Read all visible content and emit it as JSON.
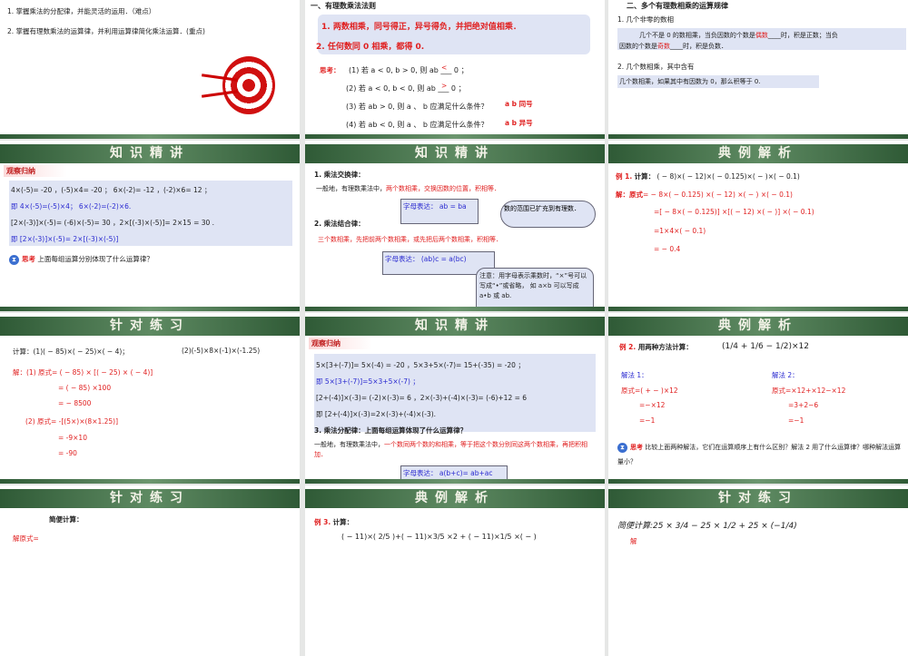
{
  "slides": [
    {
      "goals": [
        "1. 掌握乘法的分配律，并能灵活的运用．（难点）",
        "2. 掌握有理数乘法的运算律，并利用运算律简化乘法运算．(重点)"
      ]
    },
    {
      "heading": "一、有理数乘法法则",
      "rules": [
        "1. 两数相乘，同号得正，异号得负，并把绝对值相乘．",
        "2. 任何数同 0 相乘，都得 0."
      ],
      "think_label": "思考：",
      "questions": [
        "(1) 若 a < 0, b > 0, 则 ab ___ 0 ；",
        "(2) 若 a < 0, b < 0, 则 ab ___ 0 ；",
        "(3) 若 ab > 0, 则 a 、 b 应满足什么条件？",
        "(4) 若 ab < 0, 则 a 、 b 应满足什么条件？"
      ],
      "answers": [
        "<",
        ">",
        "a b 同号",
        "a b 异号"
      ]
    },
    {
      "heading": "二、多个有理数相乘的运算规律",
      "sub1": "1. 几个非零的数相",
      "box1a": "几个不是 0 的数相乘，当负因数的个数是",
      "ans1": "偶数",
      "box1b": "时，积是正数；当负",
      "box1c": "因数的个数是",
      "ans2": "奇数",
      "box1d": "时，积是负数．",
      "sub2": "2. 几个数相乘，其中含有",
      "box2": "几个数相乘，如果其中有因数为 0，那么积等于 0."
    },
    {
      "title": "知识精讲",
      "tag": "观察归纳",
      "lines": [
        "4×(-5)= -20 ，(-5)×4= -20 ；    6×(-2)= -12 ，(-2)×6= 12 ；",
        "即 4×(-5)=(-5)×4； 6×(-2)=(-2)×6.",
        "[2×(-3)]×(-5)= (-6)×(-5)= 30 ，2×[(-3)×(-5)]= 2×15 = 30 .",
        "即 [2×(-3)]×(-5)= 2×[(-3)×(-5)]"
      ],
      "think": "思考",
      "question": "上面每组运算分别体现了什么运算律？"
    },
    {
      "title": "知识精讲",
      "l1": "1. 乘法交换律：",
      "l1b": "一般地，有理数乘法中，",
      "l1r": "两个数相乘，交换因数的位置，积相等．",
      "f1": "字母表达： ab = ba",
      "cloud": "数的范围已扩充到有理数．",
      "l2": "2. 乘法结合律：",
      "l2r": "三个数相乘，先把前两个数相乘，或先把后两个数相乘，积相等．",
      "f2": "字母表达： (ab)c = a(bc)",
      "note": "注意：用字母表示乘数时，“×”号可以写成“•”或省略， 如 a×b 可以写成 a•b 或 ab."
    },
    {
      "title": "典例解析",
      "ex": "例 1.",
      "calc": "计算：",
      "expr": "( − 8)×( − 12)×( − 0.125)×( − )×( − 0.1)",
      "sol": "解：原式",
      "steps": [
        "= − 8×( − 0.125) ×( − 12) ×( − ) ×( − 0.1)",
        "=[ − 8×( − 0.125)] ×[( − 12) ×( − )] ×( − 0.1)",
        "=1×4×( − 0.1)",
        "= − 0.4"
      ]
    },
    {
      "title": "针对练习",
      "calc": "计算：(1)( − 85)×( − 25)×( − 4)；",
      "calc2": "(2)(-5)×8×(-1)×(-1.25)",
      "s1": "解：(1) 原式= ( − 85) × [( − 25) × ( − 4)]",
      "s1b": "= ( − 85) ×100",
      "s1c": "= − 8500",
      "s2": "(2) 原式= -[(5×)×(8×1.25)]",
      "s2b": "= -9×10",
      "s2c": "= -90"
    },
    {
      "title": "知识精讲",
      "tag": "观察归纳",
      "lines": [
        "5×[3+(-7)]= 5×(-4) = -20 ，5×3+5×(-7)= 15+(-35) = -20 ；",
        "即 5×[3+(-7)]=5×3+5×(-7) ；",
        "[2+(-4)]×(-3)= (-2)×(-3)= 6 ，2×(-3)+(-4)×(-3)= (-6)+12 = 6",
        "即 [2+(-4)]×(-3)=2×(-3)+(-4)×(-3)."
      ],
      "l3": "3. 乘法分配律：上面每组运算体现了什么运算律？",
      "l3b": "一般地，有理数乘法中，",
      "l3r": "一个数同两个数的和相乘，等于把这个数分别同这两个数相乘，再把积相加．",
      "f": "字母表达： a(b+c)= ab+ac"
    },
    {
      "title": "典例解析",
      "ex": "例 2.",
      "calc": "用两种方法计算：",
      "expr": "(1/4 + 1/6 − 1/2)×12",
      "m1": "解法 1：",
      "m1s": [
        "原式=( + − )×12",
        "=−×12",
        "=−1"
      ],
      "m2": "解法 2：",
      "m2s": [
        "原式=×12+×12−×12",
        "=3+2−6",
        "=−1"
      ],
      "think": "思考",
      "question": "比较上面两种解法，它们在运算顺序上有什么区别？解法 2 用了什么运算律？哪种解法运算量小？"
    },
    {
      "title": "针对练习",
      "calc": "简便计算：",
      "sol": "解原式="
    },
    {
      "title": "典例解析",
      "ex": "例 3.",
      "calc": "计算：",
      "expr": "( − 11)×( 2/5 )+( − 11)×3/5 ×2  + ( − 11)×1/5 ×( − )"
    },
    {
      "title": "针对练习",
      "calc": "简便计算:25 × 3/4 − 25 × 1/2 + 25 × (−1/4)",
      "sol": "解"
    }
  ],
  "colors": {
    "green": "#3d6b43",
    "red": "#e02020",
    "blue": "#2a2ad0",
    "box": "#dfe4f4"
  }
}
